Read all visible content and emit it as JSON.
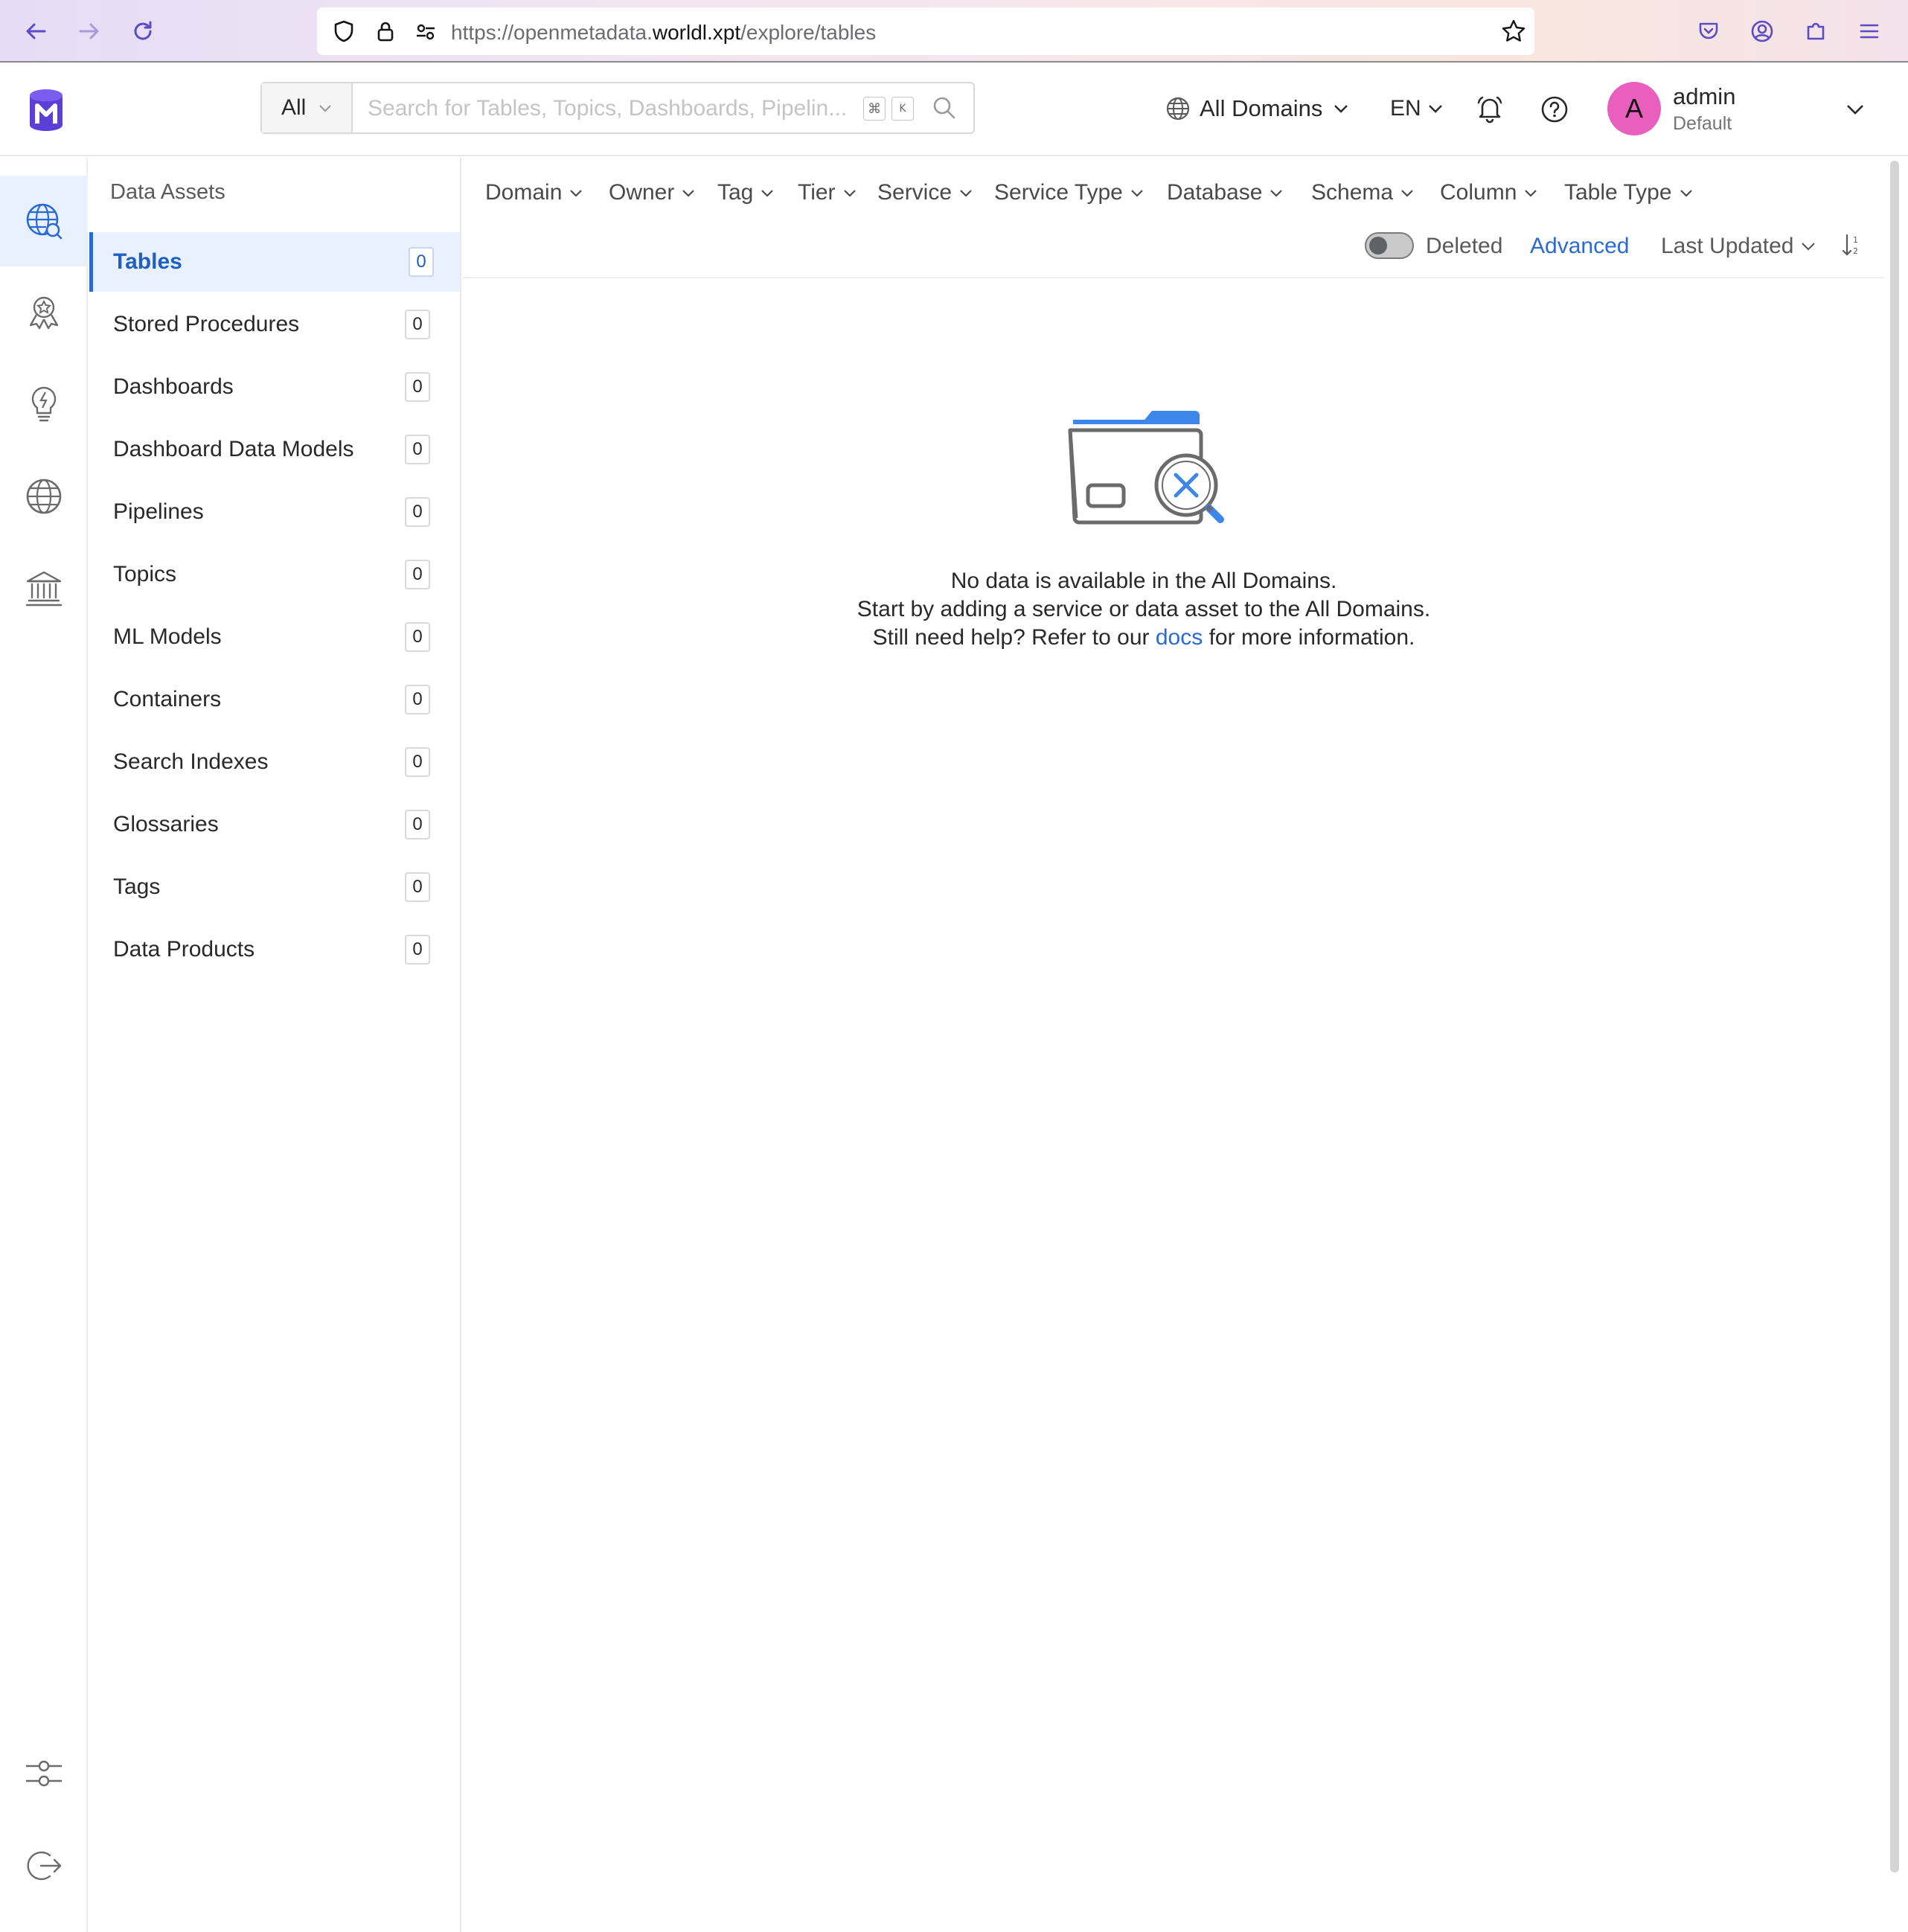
{
  "browser": {
    "url_prefix": "https://openmetadata.",
    "url_host": "worldl.xpt",
    "url_path": "/explore/tables"
  },
  "header": {
    "search": {
      "scope": "All",
      "placeholder": "Search for Tables, Topics, Dashboards, Pipelin...",
      "shortcut_cmd": "⌘",
      "shortcut_key": "K"
    },
    "domain": "All Domains",
    "language": "EN",
    "user": {
      "initial": "A",
      "name": "admin",
      "role": "Default"
    }
  },
  "rail": {
    "items": [
      "explore-icon",
      "quality-icon",
      "insights-icon",
      "domains-icon",
      "governance-icon"
    ],
    "bottom": [
      "settings-icon",
      "logout-icon"
    ]
  },
  "assets": {
    "title": "Data Assets",
    "items": [
      {
        "label": "Tables",
        "count": "0"
      },
      {
        "label": "Stored Procedures",
        "count": "0"
      },
      {
        "label": "Dashboards",
        "count": "0"
      },
      {
        "label": "Dashboard Data Models",
        "count": "0"
      },
      {
        "label": "Pipelines",
        "count": "0"
      },
      {
        "label": "Topics",
        "count": "0"
      },
      {
        "label": "ML Models",
        "count": "0"
      },
      {
        "label": "Containers",
        "count": "0"
      },
      {
        "label": "Search Indexes",
        "count": "0"
      },
      {
        "label": "Glossaries",
        "count": "0"
      },
      {
        "label": "Tags",
        "count": "0"
      },
      {
        "label": "Data Products",
        "count": "0"
      }
    ]
  },
  "filters": {
    "items": [
      "Domain",
      "Owner",
      "Tag",
      "Tier",
      "Service",
      "Service Type",
      "Database",
      "Schema",
      "Column",
      "Table Type"
    ],
    "deleted_label": "Deleted",
    "advanced_label": "Advanced",
    "sort_label": "Last Updated"
  },
  "empty_state": {
    "line1": "No data is available in the All Domains.",
    "line2": "Start by adding a service or data asset to the All Domains.",
    "line3_prefix": "Still need help? Refer to our",
    "docs_label": "docs",
    "line3_suffix": "for more information."
  },
  "colors": {
    "accent": "#2a6ad4",
    "active_bg": "#e8f1fd",
    "avatar": "#e85fbd",
    "brand": "#5b3fd6"
  }
}
